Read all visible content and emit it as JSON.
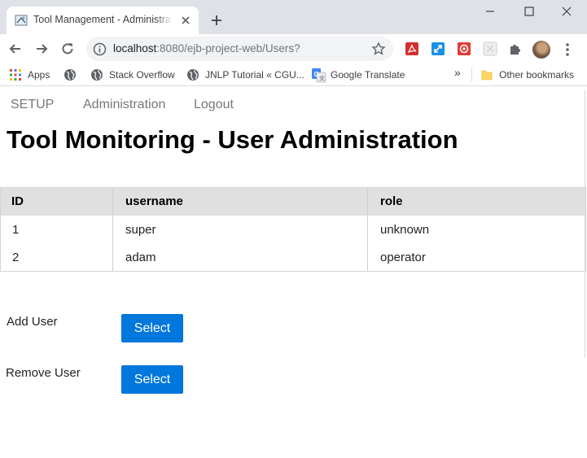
{
  "browser": {
    "tab": {
      "title": "Tool Management - Administration"
    },
    "url": {
      "host": "localhost",
      "rest": ":8080/ejb-project-web/Users?"
    },
    "bookmarks": {
      "items": [
        {
          "label": "Apps",
          "icon": "apps-grid-icon"
        },
        {
          "label": "",
          "icon": "globe-icon"
        },
        {
          "label": "Stack Overflow",
          "icon": "globe-icon"
        },
        {
          "label": "JNLP Tutorial « CGU...",
          "icon": "globe-icon"
        },
        {
          "label": "Google Translate",
          "icon": "google-translate-icon"
        }
      ],
      "overflow": "»",
      "other": "Other bookmarks"
    },
    "colors": {
      "tabstrip": "#dee1e6",
      "omnibox": "#f1f3f4"
    }
  },
  "nav": {
    "items": [
      {
        "label": "SETUP"
      },
      {
        "label": "Administration"
      },
      {
        "label": "Logout"
      }
    ]
  },
  "page": {
    "title": "Tool Monitoring - User Administration"
  },
  "table": {
    "columns": [
      "ID",
      "username",
      "role"
    ],
    "rows": [
      [
        "1",
        "super",
        "unknown"
      ],
      [
        "2",
        "adam",
        "operator"
      ]
    ],
    "header_color": "#e0e0e0"
  },
  "form": {
    "add_user_label": "Add User",
    "remove_user_label": "Remove User",
    "select_label": "Select",
    "button_color": "#0077dd"
  }
}
